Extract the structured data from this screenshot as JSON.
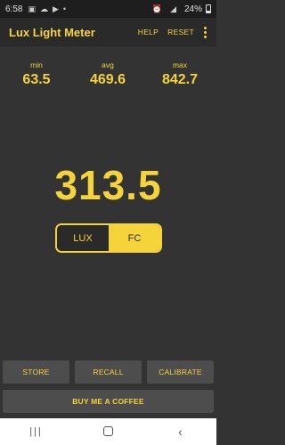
{
  "status": {
    "time": "6:58",
    "battery": "24%"
  },
  "appbar": {
    "title": "Lux Light Meter",
    "help_label": "HELP",
    "reset_label": "RESET"
  },
  "stats": {
    "min_label": "min",
    "min_value": "63.5",
    "avg_label": "avg",
    "avg_value": "469.6",
    "max_label": "max",
    "max_value": "842.7"
  },
  "reading": {
    "value": "313.5"
  },
  "unit_toggle": {
    "lux_label": "LUX",
    "fc_label": "FC",
    "selected": "FC"
  },
  "buttons": {
    "store_label": "STORE",
    "recall_label": "RECALL",
    "calibrate_label": "CALIBRATE",
    "coffee_label": "BUY ME A COFFEE"
  },
  "colors": {
    "accent": "#f5d33a",
    "background": "#333333",
    "button": "#4d4d4d"
  }
}
